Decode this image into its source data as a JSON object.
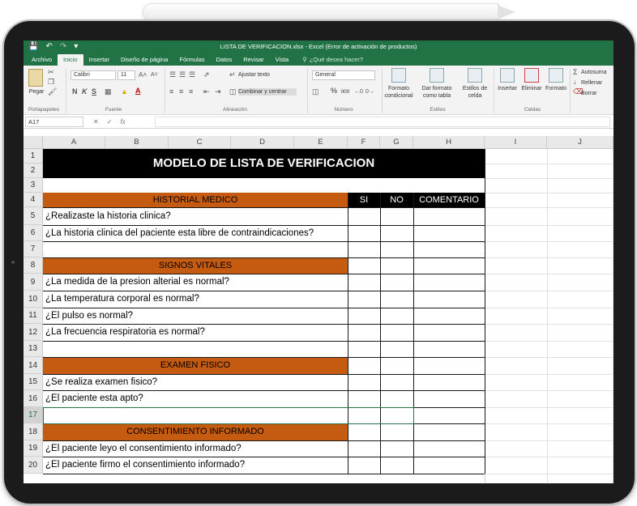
{
  "excel": {
    "qat": {
      "save_icon": "save-icon",
      "undo_icon": "undo-icon",
      "redo_icon": "redo-icon"
    },
    "window_title": "LISTA DE VERIFICACION.xlsx - Excel (Error de activación de productos)",
    "tabs": [
      "Archivo",
      "Inicio",
      "Insertar",
      "Diseño de página",
      "Fórmulas",
      "Datos",
      "Revisar",
      "Vista"
    ],
    "active_tab": "Inicio",
    "tell_me": "¿Qué desea hacer?",
    "ribbon": {
      "paste": "Pegar",
      "font_name": "Calibri",
      "font_size": "11",
      "bold": "N",
      "italic": "K",
      "underline": "S",
      "wrap_text": "Ajustar texto",
      "merge_center": "Combinar y centrar",
      "number_format": "General",
      "percent": "%",
      "thousands": "000",
      "cond_format": [
        "Formato",
        "condicional"
      ],
      "format_table": [
        "Dar formato",
        "como tabla"
      ],
      "cell_styles": [
        "Estilos de",
        "celda"
      ],
      "insert": "Insertar",
      "delete": "Eliminar",
      "format": "Formato",
      "autosum": "Autosuma",
      "fill": "Rellenar",
      "clear": "Borrar",
      "groups": [
        "Portapapeles",
        "Fuente",
        "Alineación",
        "Número",
        "Estilos",
        "Celdas"
      ]
    },
    "name_box": "A17",
    "formula_icons": [
      "✕",
      "✓",
      "fx"
    ],
    "formula_value": ""
  },
  "sheet": {
    "columns": [
      "A",
      "B",
      "C",
      "D",
      "E",
      "F",
      "G",
      "H",
      "I",
      "J"
    ],
    "rows": [
      "1",
      "2",
      "3",
      "4",
      "5",
      "6",
      "7",
      "8",
      "9",
      "10",
      "11",
      "12",
      "13",
      "14",
      "15",
      "16",
      "17",
      "18",
      "19",
      "20"
    ],
    "title": "MODELO DE LISTA DE VERIFICACION",
    "col_headers": {
      "si": "SI",
      "no": "NO",
      "comment": "COMENTARIO"
    },
    "sections": [
      {
        "title": "HISTORIAL MEDICO",
        "questions": [
          "¿Realizaste la historia clinica?",
          "¿La historia clinica del paciente esta libre de contraindicaciones?"
        ]
      },
      {
        "title": "SIGNOS VITALES",
        "questions": [
          "¿La medida de la presion alterial es normal?",
          "¿La temperatura corporal es normal?",
          "¿El pulso es normal?",
          "¿La frecuencia respiratoria es normal?"
        ]
      },
      {
        "title": "EXAMEN FISICO",
        "questions": [
          "¿Se realiza examen fisico?",
          "¿El paciente esta apto?"
        ]
      },
      {
        "title": "CONSENTIMIENTO INFORMADO",
        "questions": [
          "¿El paciente leyo el consentimiento informado?",
          "¿El paciente firmo el consentimiento informado?"
        ]
      }
    ]
  },
  "colors": {
    "excel_green": "#217346",
    "section_orange": "#c55a11",
    "title_black": "#000000"
  }
}
